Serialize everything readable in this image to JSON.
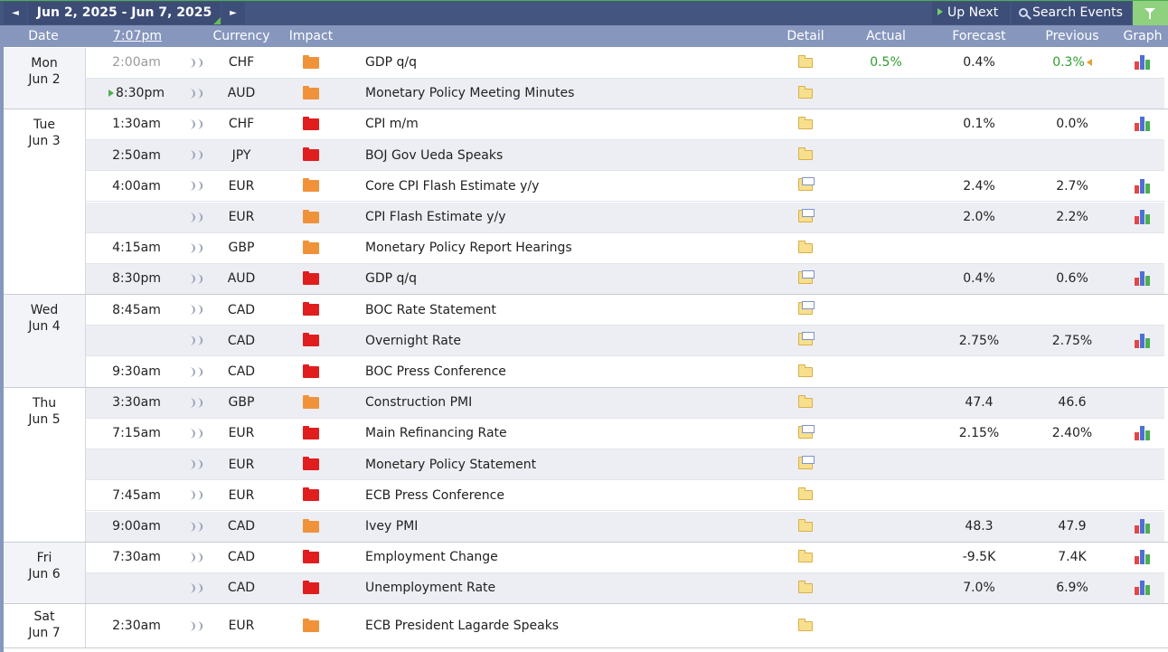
{
  "toolbar": {
    "prev_icon": "◄",
    "next_icon": "►",
    "date_range": "Jun 2, 2025 - Jun 7, 2025",
    "up_next": "Up Next",
    "search_events": "Search Events"
  },
  "header": {
    "date": "Date",
    "time": "7:07pm",
    "currency": "Currency",
    "impact": "Impact",
    "detail": "Detail",
    "actual": "Actual",
    "forecast": "Forecast",
    "previous": "Previous",
    "graph": "Graph"
  },
  "colors": {
    "topbar": "#44567f",
    "header": "#8696bd",
    "high_impact": "#e01e1e",
    "medium_impact": "#f0923a",
    "actual_better": "#2e9e2e"
  },
  "days": [
    {
      "weekday": "Mon",
      "date": "Jun 2",
      "events": [
        {
          "time": "2:00am",
          "currency": "CHF",
          "impact": "medium",
          "title": "GDP q/q",
          "detail": "closed",
          "actual": "0.5%",
          "forecast": "0.4%",
          "previous": "0.3%",
          "graph": true
        },
        {
          "time": "8:30pm",
          "currency": "AUD",
          "impact": "medium",
          "title": "Monetary Policy Meeting Minutes",
          "detail": "closed",
          "actual": "",
          "forecast": "",
          "previous": "",
          "graph": false
        }
      ]
    },
    {
      "weekday": "Tue",
      "date": "Jun 3",
      "events": [
        {
          "time": "1:30am",
          "currency": "CHF",
          "impact": "high",
          "title": "CPI m/m",
          "detail": "closed",
          "actual": "",
          "forecast": "0.1%",
          "previous": "0.0%",
          "graph": true
        },
        {
          "time": "2:50am",
          "currency": "JPY",
          "impact": "high",
          "title": "BOJ Gov Ueda Speaks",
          "detail": "closed",
          "actual": "",
          "forecast": "",
          "previous": "",
          "graph": false
        },
        {
          "time": "4:00am",
          "currency": "EUR",
          "impact": "medium",
          "title": "Core CPI Flash Estimate y/y",
          "detail": "open",
          "actual": "",
          "forecast": "2.4%",
          "previous": "2.7%",
          "graph": true
        },
        {
          "time": "",
          "currency": "EUR",
          "impact": "medium",
          "title": "CPI Flash Estimate y/y",
          "detail": "open",
          "actual": "",
          "forecast": "2.0%",
          "previous": "2.2%",
          "graph": true
        },
        {
          "time": "4:15am",
          "currency": "GBP",
          "impact": "medium",
          "title": "Monetary Policy Report Hearings",
          "detail": "closed",
          "actual": "",
          "forecast": "",
          "previous": "",
          "graph": false
        },
        {
          "time": "8:30pm",
          "currency": "AUD",
          "impact": "high",
          "title": "GDP q/q",
          "detail": "open",
          "actual": "",
          "forecast": "0.4%",
          "previous": "0.6%",
          "graph": true
        }
      ]
    },
    {
      "weekday": "Wed",
      "date": "Jun 4",
      "events": [
        {
          "time": "8:45am",
          "currency": "CAD",
          "impact": "high",
          "title": "BOC Rate Statement",
          "detail": "open",
          "actual": "",
          "forecast": "",
          "previous": "",
          "graph": false
        },
        {
          "time": "",
          "currency": "CAD",
          "impact": "high",
          "title": "Overnight Rate",
          "detail": "open",
          "actual": "",
          "forecast": "2.75%",
          "previous": "2.75%",
          "graph": true
        },
        {
          "time": "9:30am",
          "currency": "CAD",
          "impact": "high",
          "title": "BOC Press Conference",
          "detail": "closed",
          "actual": "",
          "forecast": "",
          "previous": "",
          "graph": false
        }
      ]
    },
    {
      "weekday": "Thu",
      "date": "Jun 5",
      "events": [
        {
          "time": "3:30am",
          "currency": "GBP",
          "impact": "medium",
          "title": "Construction PMI",
          "detail": "closed",
          "actual": "",
          "forecast": "47.4",
          "previous": "46.6",
          "graph": false
        },
        {
          "time": "7:15am",
          "currency": "EUR",
          "impact": "high",
          "title": "Main Refinancing Rate",
          "detail": "open",
          "actual": "",
          "forecast": "2.15%",
          "previous": "2.40%",
          "graph": true
        },
        {
          "time": "",
          "currency": "EUR",
          "impact": "high",
          "title": "Monetary Policy Statement",
          "detail": "open",
          "actual": "",
          "forecast": "",
          "previous": "",
          "graph": false
        },
        {
          "time": "7:45am",
          "currency": "EUR",
          "impact": "high",
          "title": "ECB Press Conference",
          "detail": "closed",
          "actual": "",
          "forecast": "",
          "previous": "",
          "graph": false
        },
        {
          "time": "9:00am",
          "currency": "CAD",
          "impact": "medium",
          "title": "Ivey PMI",
          "detail": "closed",
          "actual": "",
          "forecast": "48.3",
          "previous": "47.9",
          "graph": true
        }
      ]
    },
    {
      "weekday": "Fri",
      "date": "Jun 6",
      "events": [
        {
          "time": "7:30am",
          "currency": "CAD",
          "impact": "high",
          "title": "Employment Change",
          "detail": "closed",
          "actual": "",
          "forecast": "-9.5K",
          "previous": "7.4K",
          "graph": true
        },
        {
          "time": "",
          "currency": "CAD",
          "impact": "high",
          "title": "Unemployment Rate",
          "detail": "closed",
          "actual": "",
          "forecast": "7.0%",
          "previous": "6.9%",
          "graph": true
        }
      ]
    },
    {
      "weekday": "Sat",
      "date": "Jun 7",
      "events": [
        {
          "time": "2:30am",
          "currency": "EUR",
          "impact": "medium",
          "title": "ECB President Lagarde Speaks",
          "detail": "closed",
          "actual": "",
          "forecast": "",
          "previous": "",
          "graph": false
        }
      ]
    }
  ]
}
